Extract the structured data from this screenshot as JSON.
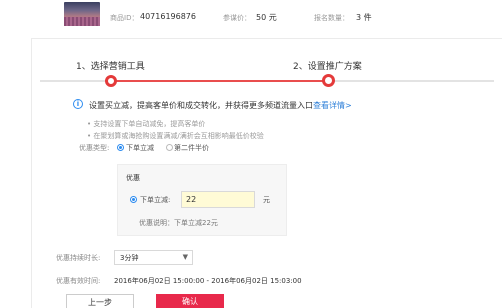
{
  "product": {
    "id_label": "商品ID：",
    "id_value": "40716196876",
    "price_label": "参谋价：",
    "price_value": "50 元",
    "signup_label": "报名数量：",
    "signup_value": "3 件"
  },
  "steps": [
    {
      "label": "1、选择营销工具"
    },
    {
      "label": "2、设置推广方案"
    }
  ],
  "info": {
    "icon": "info-circle-icon",
    "text": "设置买立减，提高客单价和成交转化，并获得更多频道流量入口",
    "link": "查看详情>"
  },
  "bullets": [
    "• 支持设置下单自动减免，提高客单价",
    "• 在聚划算或海抢购设置满减/满折会互相影响最低价校验"
  ],
  "discount_type": {
    "label": "优惠类型:",
    "options": [
      {
        "label": "下单立减",
        "selected": true
      },
      {
        "label": "第二件半价",
        "selected": false
      }
    ]
  },
  "offer_box": {
    "title": "优惠",
    "option_label": "下单立减:",
    "amount": "22",
    "unit": "元",
    "explain": "优惠说明：下单立减22元"
  },
  "duration": {
    "label": "优惠持续时长:",
    "value": "3分钟",
    "caret": "▼"
  },
  "validity": {
    "label": "优惠有效时间:",
    "value": "2016年06月02日 15:00:00 - 2016年06月02日 15:03:00"
  },
  "buttons": {
    "prev": "上一步",
    "confirm": "确认"
  },
  "colors": {
    "accent": "#e43a3a",
    "link": "#2d7fd8",
    "confirm": "#e8294b"
  }
}
